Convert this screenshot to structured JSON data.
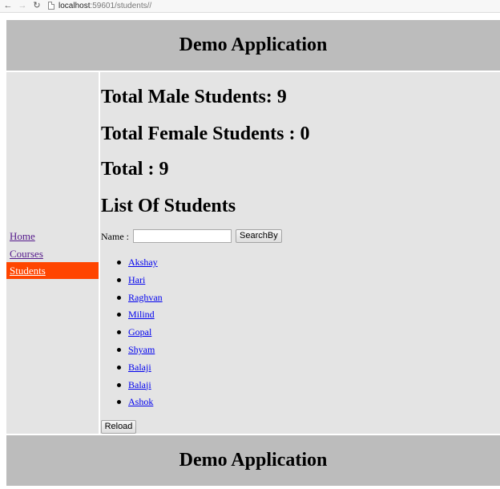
{
  "browser": {
    "url_host": "localhost",
    "url_path": ":59601/students//"
  },
  "header": {
    "title": "Demo Application"
  },
  "sidebar": {
    "items": [
      {
        "label": "Home"
      },
      {
        "label": "Courses"
      },
      {
        "label": "Students",
        "active": true
      }
    ],
    "active_color": "#ff4500"
  },
  "main": {
    "total_male": "Total Male Students: 9",
    "total_female": "Total Female Students : 0",
    "total": "Total : 9",
    "list_heading": "List Of Students",
    "search": {
      "label": "Name :",
      "value": "",
      "button_label": "SearchBy"
    },
    "students": [
      "Akshay",
      "Hari",
      "Raghvan",
      "Milind",
      "Gopal",
      "Shyam",
      "Balaji",
      "Balaji",
      "Ashok"
    ],
    "reload_label": "Reload"
  },
  "footer": {
    "title": "Demo Application"
  },
  "colors": {
    "header_bg": "#bcbcbc",
    "panel_bg": "#e4e4e4",
    "link": "#0000ee",
    "visited_link": "#551a8b"
  }
}
